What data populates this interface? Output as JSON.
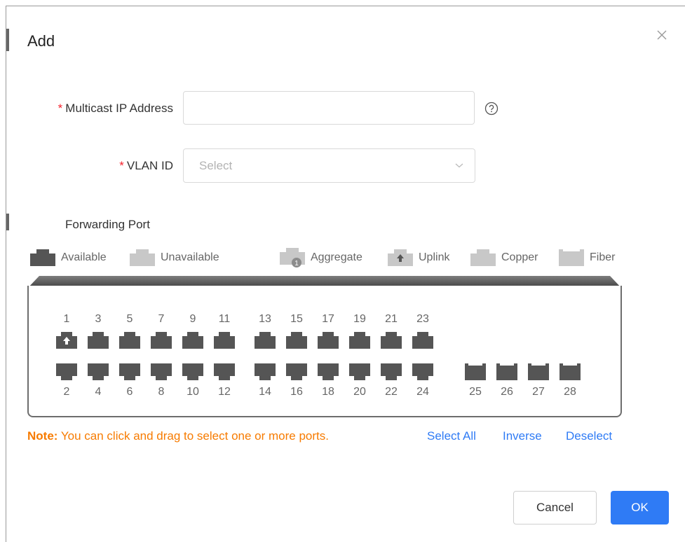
{
  "dialog": {
    "title": "Add"
  },
  "form": {
    "multicast_ip": {
      "required_mark": "*",
      "label": "Multicast IP Address",
      "value": ""
    },
    "vlan": {
      "required_mark": "*",
      "label": "VLAN ID",
      "placeholder": "Select"
    }
  },
  "forwarding": {
    "label": "Forwarding Port",
    "legend": {
      "available": "Available",
      "unavailable": "Unavailable",
      "aggregate": "Aggregate",
      "aggregate_badge": "1",
      "uplink": "Uplink",
      "copper": "Copper",
      "fiber": "Fiber"
    },
    "ports_top": [
      "1",
      "3",
      "5",
      "7",
      "9",
      "11",
      "13",
      "15",
      "17",
      "19",
      "21",
      "23"
    ],
    "ports_bottom": [
      "2",
      "4",
      "6",
      "8",
      "10",
      "12",
      "14",
      "16",
      "18",
      "20",
      "22",
      "24"
    ],
    "ports_fiber": [
      "25",
      "26",
      "27",
      "28"
    ],
    "uplink_port": "1"
  },
  "note": {
    "prefix": "Note:",
    "text": "You can click and drag to select one or more ports."
  },
  "actions": {
    "select_all": "Select All",
    "inverse": "Inverse",
    "deselect": "Deselect",
    "cancel": "Cancel",
    "ok": "OK"
  },
  "colors": {
    "available": "#555555",
    "unavailable": "#c8c8c8",
    "primary": "#2f7bf5",
    "note": "#f77b00",
    "required": "#f5222d"
  }
}
